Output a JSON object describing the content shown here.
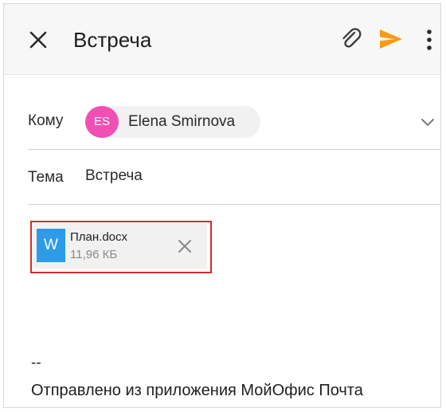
{
  "header": {
    "title": "Встреча",
    "close_icon": "close-icon",
    "attach_icon": "paperclip-icon",
    "send_icon": "send-icon",
    "more_icon": "more-vertical-icon"
  },
  "recipient": {
    "label": "Кому",
    "avatar_initials": "ES",
    "name": "Elena Smirnova",
    "avatar_color": "#f050b4",
    "expand_icon": "chevron-down-icon"
  },
  "subject": {
    "label": "Тема",
    "value": "Встреча"
  },
  "attachment": {
    "icon_letter": "W",
    "file_name": "План.docx",
    "file_size": "11,96 КБ",
    "icon_color": "#2d9be7",
    "highlight_color": "#d32c2c",
    "remove_icon": "close-icon"
  },
  "body": {
    "signature_separator": "--",
    "signature_text": "Отправлено из приложения МойОфис Почта"
  },
  "colors": {
    "send_accent": "#f59a1b",
    "appbar_background": "#f7f7f7"
  }
}
